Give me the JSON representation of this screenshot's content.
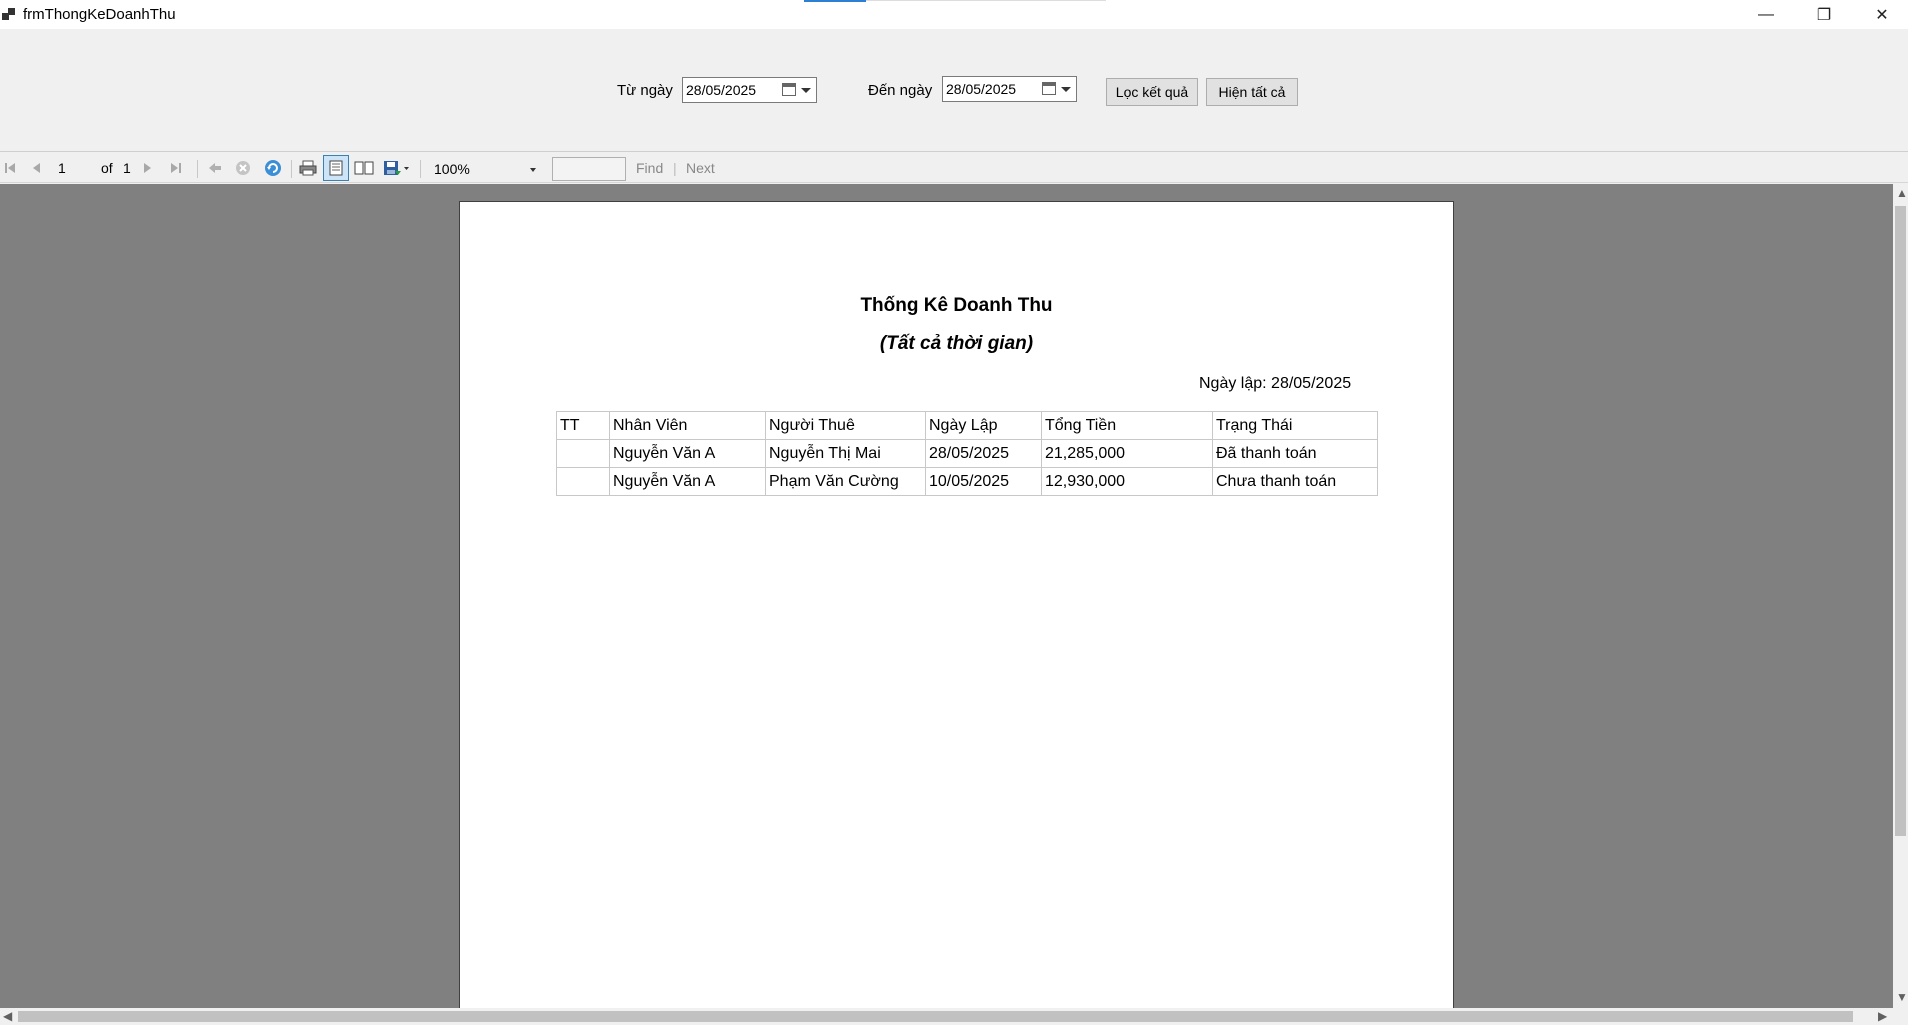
{
  "window": {
    "title": "frmThongKeDoanhThu",
    "minimize_glyph": "—",
    "maximize_glyph": "❐",
    "close_glyph": "✕"
  },
  "filter": {
    "from_label": "Từ ngày",
    "from_value": "28/05/2025",
    "to_label": "Đến ngày",
    "to_value": "28/05/2025",
    "filter_button": "Lọc kết quả",
    "show_all_button": "Hiện tất cả"
  },
  "toolbar": {
    "page_current": "1",
    "page_of": "of",
    "page_total": "1",
    "zoom": "100%",
    "find_label": "Find",
    "find_separator": "|",
    "next_label": "Next",
    "icons": [
      "first-page-icon",
      "previous-page-icon",
      "next-page-icon",
      "last-page-icon",
      "back-icon",
      "stop-icon",
      "refresh-icon",
      "print-icon",
      "print-layout-icon",
      "page-setup-icon",
      "export-icon"
    ]
  },
  "report": {
    "title": "Thống Kê Doanh Thu",
    "subtitle": "(Tất cả thời gian)",
    "date_label": "Ngày lập: 28/05/2025",
    "columns": [
      "TT",
      "Nhân Viên",
      "Người Thuê",
      "Ngày Lập",
      "Tổng Tiền",
      "Trạng Thái"
    ],
    "rows": [
      [
        "",
        "Nguyễn Văn A",
        "Nguyễn Thị Mai",
        "28/05/2025",
        "21,285,000",
        "Đã thanh toán"
      ],
      [
        "",
        "Nguyễn Văn A",
        "Phạm Văn Cường",
        "10/05/2025",
        "12,930,000",
        "Chưa thanh toán"
      ]
    ]
  },
  "colors": {
    "accent": "#2d7fd1",
    "viewer_background": "#808080",
    "window_background": "#f0f0f0"
  }
}
